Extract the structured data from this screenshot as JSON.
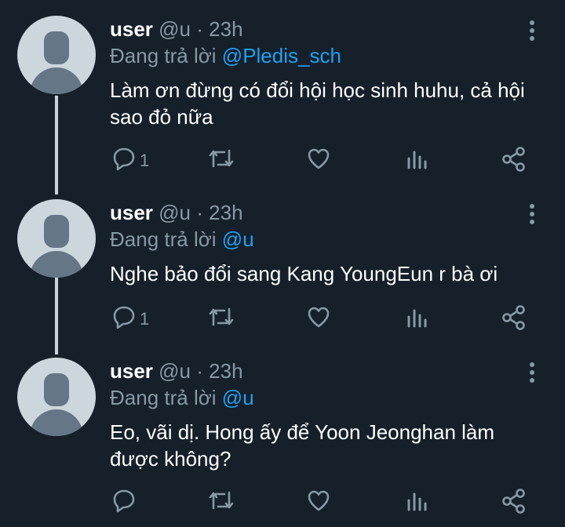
{
  "colors": {
    "background": "#15202b",
    "text": "#ffffff",
    "muted": "#8899a6",
    "accent": "#1da1f2",
    "avatar_bg": "#ccd6dd",
    "avatar_fg": "#657786"
  },
  "tweets": [
    {
      "username": "user",
      "handle": "@u",
      "separator": "·",
      "time": "23h",
      "replying_prefix": "Đang trả lời",
      "replying_to": "@Pledis_sch",
      "text": "Làm ơn đừng có đổi hội học sinh huhu, cả hội sao đỏ nữa",
      "reply_count": "1",
      "icons": [
        "reply-icon",
        "retweet-icon",
        "like-icon",
        "analytics-icon",
        "share-icon",
        "more-icon"
      ]
    },
    {
      "username": "user",
      "handle": "@u",
      "separator": "·",
      "time": "23h",
      "replying_prefix": "Đang trả lời",
      "replying_to": "@u",
      "text": "Nghe bảo đổi sang Kang YoungEun r bà ơi",
      "reply_count": "1",
      "icons": [
        "reply-icon",
        "retweet-icon",
        "like-icon",
        "analytics-icon",
        "share-icon",
        "more-icon"
      ]
    },
    {
      "username": "user",
      "handle": "@u",
      "separator": "·",
      "time": "23h",
      "replying_prefix": "Đang trả lời",
      "replying_to": "@u",
      "text": "Eo, vãi dị. Hong ấy để Yoon Jeonghan làm được không?",
      "reply_count": "",
      "icons": [
        "reply-icon",
        "retweet-icon",
        "like-icon",
        "analytics-icon",
        "share-icon",
        "more-icon"
      ]
    }
  ]
}
